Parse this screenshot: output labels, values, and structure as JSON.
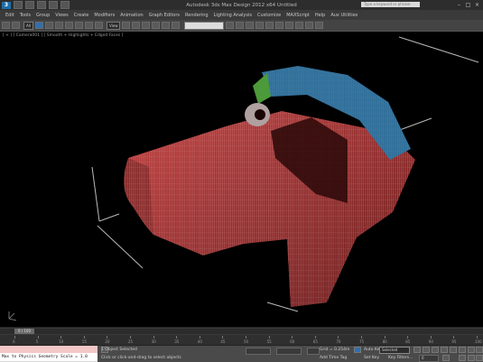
{
  "window": {
    "title": "Autodesk 3ds Max Design 2012 x64     Untitled",
    "search_placeholder": "Type a keyword or phrase"
  },
  "menu": [
    "Edit",
    "Tools",
    "Group",
    "Views",
    "Create",
    "Modifiers",
    "Animation",
    "Graph Editors",
    "Rendering",
    "Lighting Analysis",
    "Customize",
    "MAXScript",
    "Help",
    "Aux Utilities"
  ],
  "toolbar": {
    "filter": "All",
    "view": "View"
  },
  "viewport": {
    "label": "[ + ] [ Camera001 ] [ Smooth + Highlights + Edged Faces ]"
  },
  "timeline": {
    "slider_label": "0 / 100",
    "ticks": [
      "0",
      "5",
      "10",
      "15",
      "20",
      "25",
      "30",
      "35",
      "40",
      "45",
      "50",
      "55",
      "60",
      "65",
      "70",
      "75",
      "80",
      "85",
      "90",
      "95",
      "100"
    ]
  },
  "status": {
    "maxscript_output": "Max to Physics Geometry Scale = 1.0",
    "objects_selected": "1 Object Selected",
    "prompt": "Click or click-and-drag to select objects",
    "grid": "Grid = 0.254m",
    "add_time_tag": "Add Time Tag",
    "auto_key": "Auto Key",
    "selected": "Selected",
    "set_key": "Set Key",
    "key_filters": "Key Filters...",
    "frame": "0"
  }
}
